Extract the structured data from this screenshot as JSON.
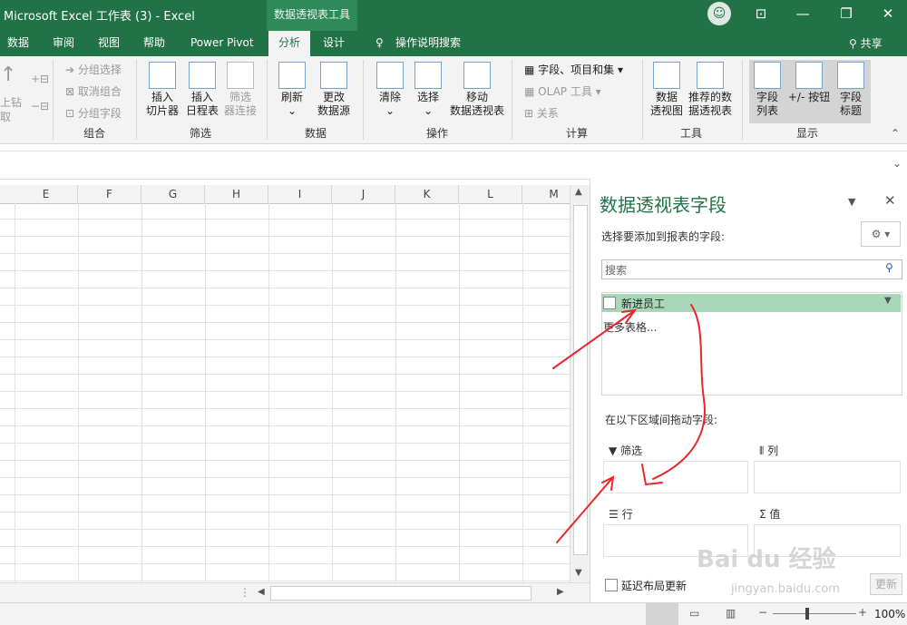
{
  "window": {
    "title": "Microsoft Excel 工作表 (3)  -  Excel",
    "contextual_tab": "数据透视表工具",
    "min": "—",
    "max": "❐",
    "close": "✕"
  },
  "tabs": [
    "数据",
    "审阅",
    "视图",
    "帮助",
    "Power Pivot",
    "分析",
    "设计"
  ],
  "tell_me": "操作说明搜索",
  "share": "共享",
  "ribbon": {
    "leftgroup": {
      "l1": "上钻",
      "l2": "取"
    },
    "group_combine": {
      "label": "组合",
      "items": [
        "分组选择",
        "取消组合",
        "分组字段"
      ]
    },
    "group_filter": {
      "label": "筛选",
      "slicer": [
        "插入",
        "切片器"
      ],
      "timeline": [
        "插入",
        "日程表"
      ],
      "connections": [
        "筛选",
        "器连接"
      ]
    },
    "group_data": {
      "label": "数据",
      "refresh": [
        "刷新"
      ],
      "change_source": [
        "更改",
        "数据源"
      ]
    },
    "group_actions": {
      "label": "操作",
      "clear": [
        "清除"
      ],
      "select": [
        "选择"
      ],
      "move": [
        "移动",
        "数据透视表"
      ]
    },
    "group_calc": {
      "label": "计算",
      "items": [
        "字段、项目和集",
        "OLAP 工具",
        "关系"
      ]
    },
    "group_tools": {
      "label": "工具",
      "pivotchart": [
        "数据",
        "透视图"
      ],
      "recommended": [
        "推荐的数",
        "据透视表"
      ]
    },
    "group_show": {
      "label": "显示",
      "field_list": [
        "字段",
        "列表"
      ],
      "buttons": [
        "+/- 按钮"
      ],
      "headers": [
        "字段",
        "标题"
      ]
    }
  },
  "columns": [
    "E",
    "F",
    "G",
    "H",
    "I",
    "J",
    "K",
    "L",
    "M"
  ],
  "pane": {
    "title": "数据透视表字段",
    "choose_label": "选择要添加到报表的字段:",
    "search_placeholder": "搜索",
    "field": "新进员工",
    "more_tables": "更多表格...",
    "drag_label": "在以下区域间拖动字段:",
    "zones": {
      "filter": "筛选",
      "columns": "列",
      "rows": "行",
      "values": "值"
    },
    "defer_label": "延迟布局更新",
    "update_button": "更新"
  },
  "status": {
    "zoom": "100%"
  },
  "watermark": {
    "brand": "Bai du 经验",
    "url": "jingyan.baidu.com"
  },
  "colors": {
    "excel_green": "#217346",
    "annotation_red": "#e8262b"
  }
}
